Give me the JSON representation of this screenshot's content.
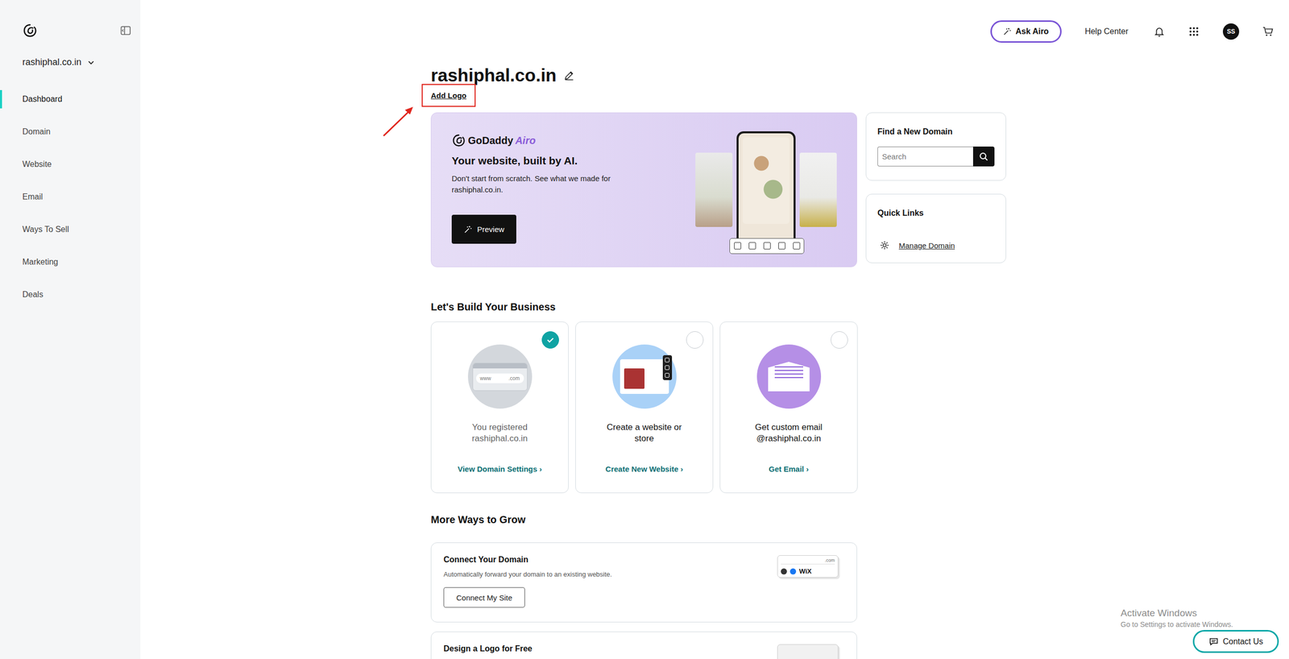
{
  "sidebar": {
    "domain_selector": "rashiphal.co.in",
    "items": [
      {
        "label": "Dashboard",
        "selected": true
      },
      {
        "label": "Domain",
        "selected": false
      },
      {
        "label": "Website",
        "selected": false
      },
      {
        "label": "Email",
        "selected": false
      },
      {
        "label": "Ways To Sell",
        "selected": false
      },
      {
        "label": "Marketing",
        "selected": false
      },
      {
        "label": "Deals",
        "selected": false
      }
    ]
  },
  "topbar": {
    "ask_button": "Ask Airo",
    "help": "Help Center",
    "avatar": "SS"
  },
  "page": {
    "title": "rashiphal.co.in",
    "add_logo": "Add Logo"
  },
  "airo_card": {
    "brand": "GoDaddy",
    "brand_suffix": "Airo",
    "title": "Your website, built by AI.",
    "text": "Don't start from scratch. See what we made for rashiphal.co.in.",
    "button": "Preview"
  },
  "find_domain": {
    "title": "Find a New Domain",
    "placeholder": "Search"
  },
  "quick_links": {
    "title": "Quick Links",
    "links": [
      "Manage Domain"
    ]
  },
  "build": {
    "title": "Let's Build Your Business",
    "chevron": "›",
    "cards": [
      {
        "kind": "domain",
        "text": "You registered rashiphal.co.in",
        "link": "View Domain Settings",
        "checked": true,
        "labels": [
          "www",
          ".com"
        ]
      },
      {
        "kind": "website",
        "text": "Create a website or store",
        "link": "Create New Website",
        "checked": false,
        "labels": []
      },
      {
        "kind": "email",
        "text": "Get custom email @rashiphal.co.in",
        "link": "Get Email",
        "checked": false,
        "labels": []
      }
    ]
  },
  "grow": {
    "title": "More Ways to Grow",
    "cards": [
      {
        "title": "Connect Your Domain",
        "text": "Automatically forward your domain to an existing website.",
        "button": "Connect My Site",
        "labels": [
          ".com",
          "WiX"
        ]
      },
      {
        "title": "Design a Logo for Free",
        "text": "",
        "button": "",
        "labels": []
      }
    ]
  },
  "watermark": {
    "title": "Activate Windows",
    "text": "Go to Settings to activate Windows."
  },
  "contact": "Contact Us"
}
